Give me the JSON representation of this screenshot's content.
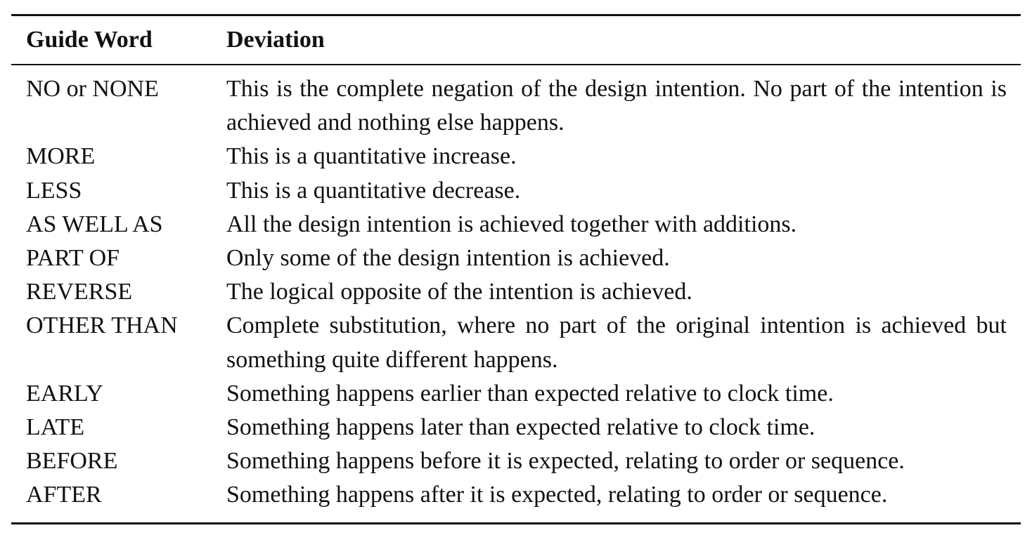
{
  "table": {
    "headers": {
      "guide_word": "Guide Word",
      "deviation": "Deviation"
    },
    "rows": [
      {
        "guide_word": "NO or NONE",
        "deviation": "This is the complete negation of the design intention.  No part of the intention is achieved and nothing else happens."
      },
      {
        "guide_word": "MORE",
        "deviation": "This is a quantitative increase."
      },
      {
        "guide_word": "LESS",
        "deviation": "This is a quantitative decrease."
      },
      {
        "guide_word": "AS WELL AS",
        "deviation": "All the design intention is achieved together with additions."
      },
      {
        "guide_word": "PART OF",
        "deviation": "Only some of the design intention is achieved."
      },
      {
        "guide_word": "REVERSE",
        "deviation": "The logical opposite of the intention is achieved."
      },
      {
        "guide_word": "OTHER THAN",
        "deviation": "Complete substitution, where no part of the original intention is achieved but something quite different happens."
      },
      {
        "guide_word": "EARLY",
        "deviation": "Something happens earlier than expected relative to clock time."
      },
      {
        "guide_word": "LATE",
        "deviation": "Something happens later than expected relative to clock time."
      },
      {
        "guide_word": "BEFORE",
        "deviation": "Something happens before it is expected, relating to order or sequence."
      },
      {
        "guide_word": "AFTER",
        "deviation": "Something happens after it is expected, relating to order or sequence."
      }
    ]
  }
}
